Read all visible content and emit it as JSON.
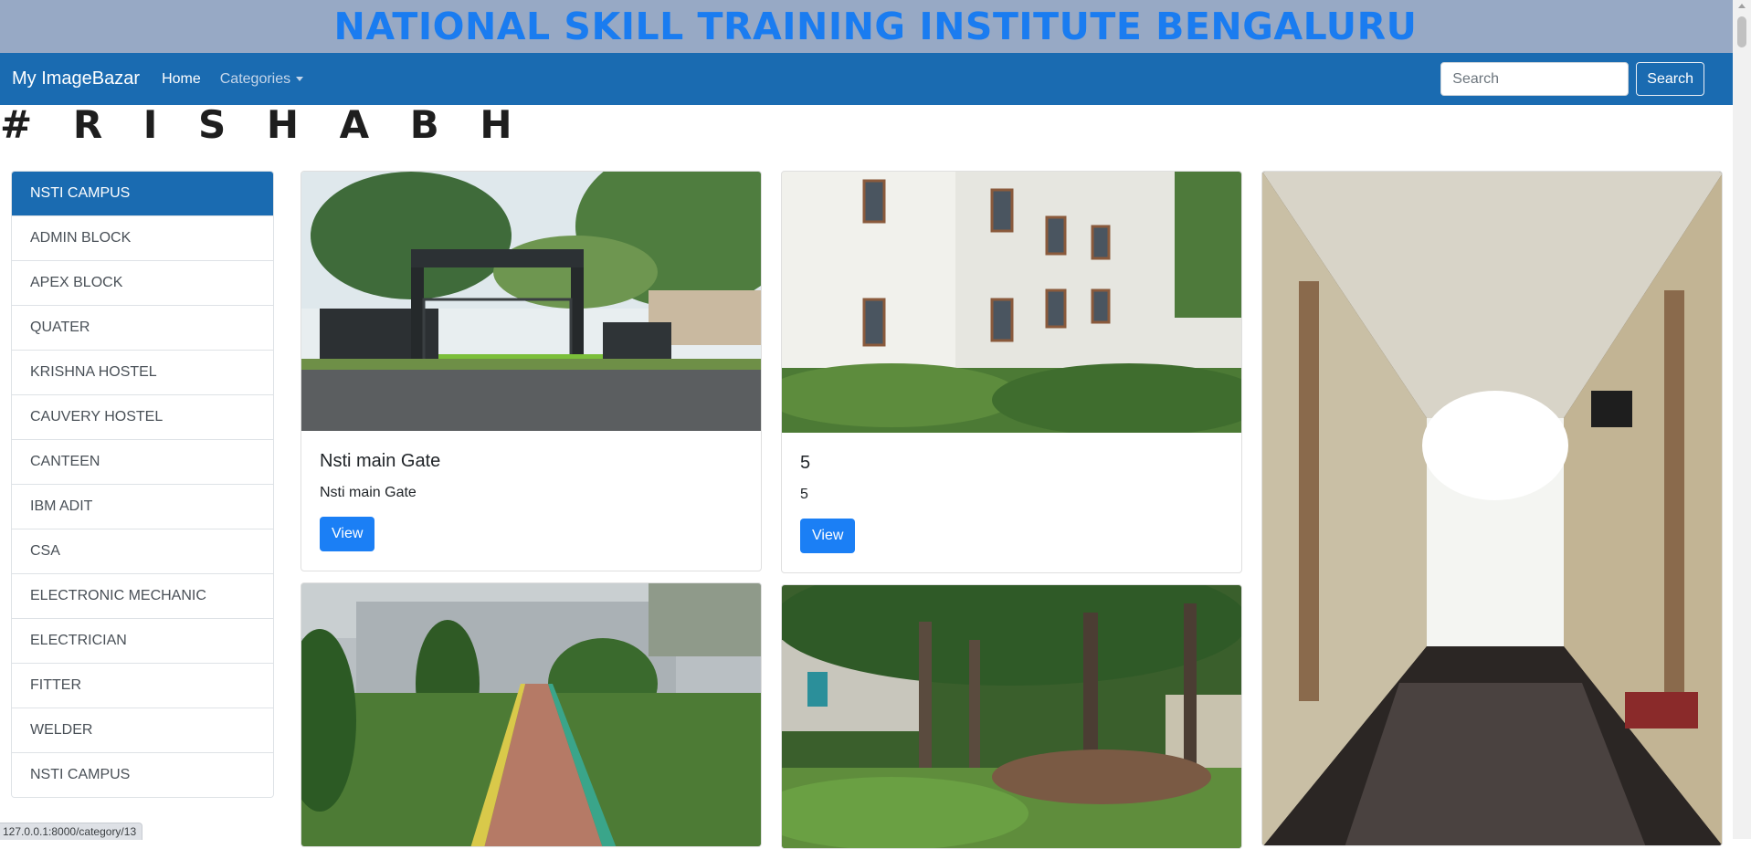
{
  "banner": {
    "title": "NATIONAL SKILL TRAINING INSTITUTE BENGALURU"
  },
  "navbar": {
    "brand": "My ImageBazar",
    "home": "Home",
    "categories": "Categories",
    "search_placeholder": "Search",
    "search_button": "Search"
  },
  "heading": "# R I S H A B H",
  "sidebar": {
    "items": [
      {
        "label": "NSTI CAMPUS",
        "active": true
      },
      {
        "label": "ADMIN BLOCK"
      },
      {
        "label": "APEX BLOCK"
      },
      {
        "label": "QUATER"
      },
      {
        "label": "KRISHNA HOSTEL"
      },
      {
        "label": "CAUVERY HOSTEL"
      },
      {
        "label": "CANTEEN"
      },
      {
        "label": "IBM ADIT"
      },
      {
        "label": "CSA"
      },
      {
        "label": "ELECTRONIC MECHANIC"
      },
      {
        "label": "ELECTRICIAN"
      },
      {
        "label": "FITTER"
      },
      {
        "label": "WELDER"
      },
      {
        "label": "NSTI CAMPUS"
      }
    ]
  },
  "cards": [
    {
      "title": "Nsti main Gate",
      "text": "Nsti main Gate",
      "button": "View",
      "image": "main-gate-photo"
    },
    {
      "title": "5",
      "text": "5",
      "button": "View",
      "image": "building-photo"
    },
    {
      "image": "corridor-photo"
    },
    {
      "image": "walkway-photo"
    },
    {
      "image": "garden-photo"
    }
  ],
  "status_bar": {
    "url": "127.0.0.1:8000/category/13"
  },
  "colors": {
    "banner_bg": "#97a9c5",
    "banner_text": "#1a7cf0",
    "navbar_bg": "#1a6bb1",
    "active_item": "#1a6bb1",
    "primary_button": "#1b7ff5"
  }
}
